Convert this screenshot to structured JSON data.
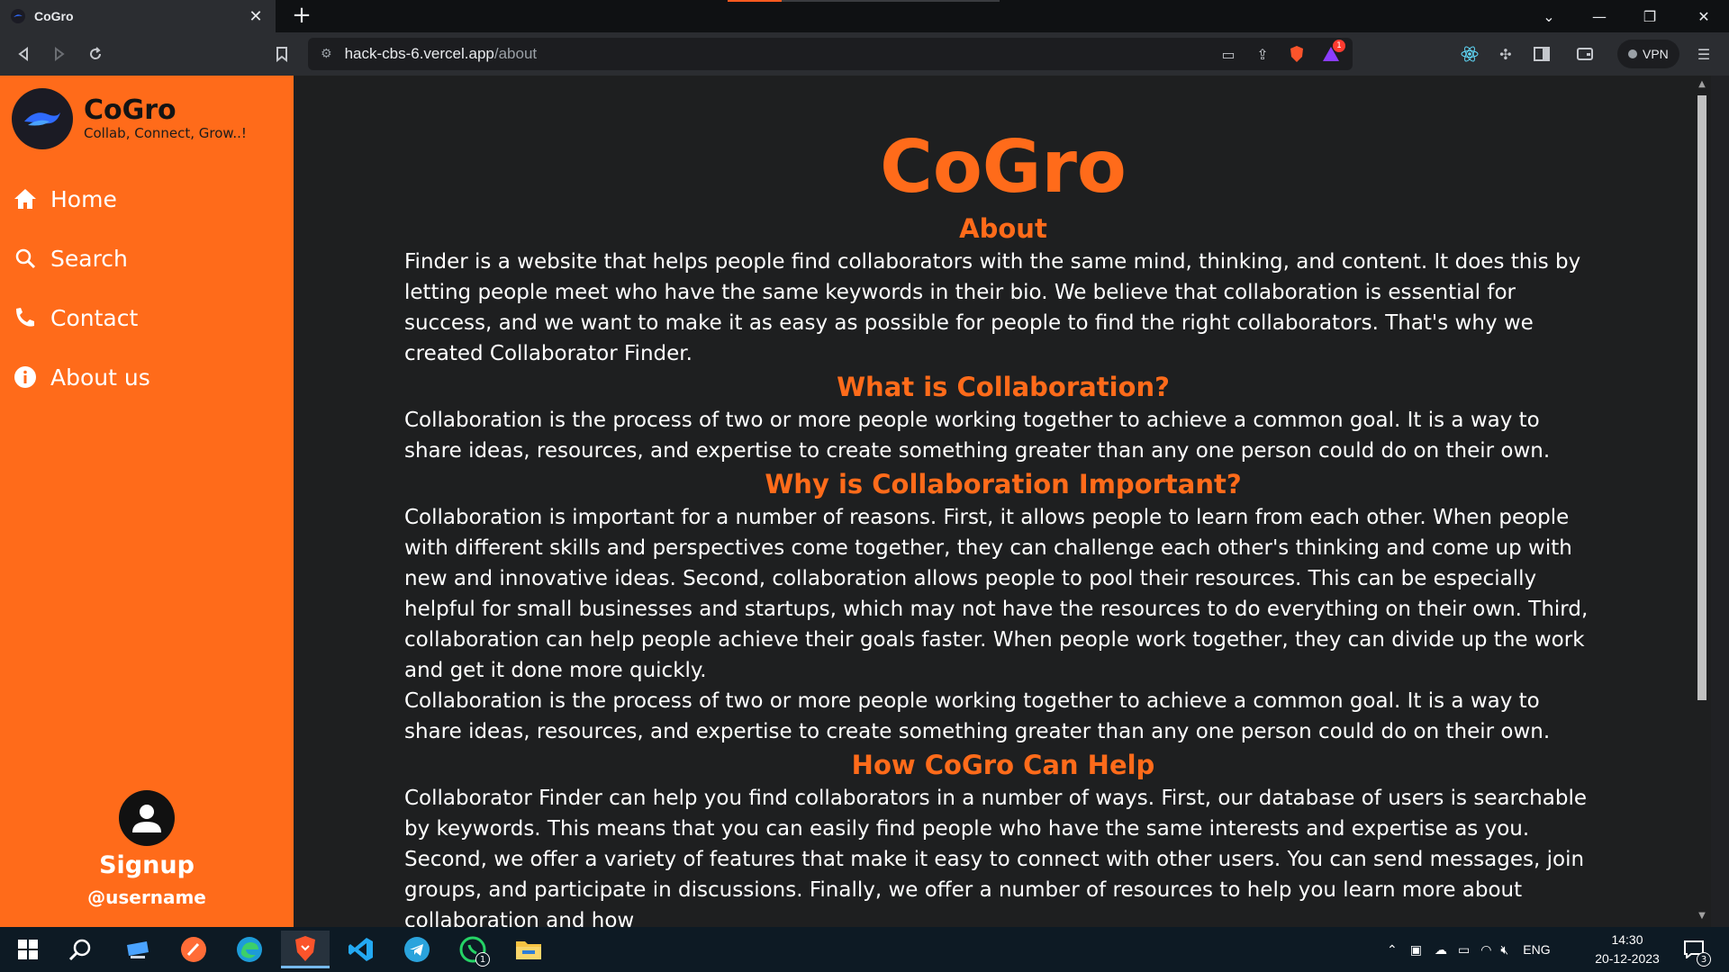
{
  "browser": {
    "tab_title": "CoGro",
    "url_host": "hack-cbs-6.vercel.app",
    "url_path": "/about",
    "vpn_label": "VPN",
    "notification_count": "1"
  },
  "sidebar": {
    "brand_name": "CoGro",
    "tagline": "Collab, Connect, Grow..!",
    "items": [
      {
        "label": "Home",
        "icon": "home-icon"
      },
      {
        "label": "Search",
        "icon": "search-icon"
      },
      {
        "label": "Contact",
        "icon": "phone-icon"
      },
      {
        "label": "About us",
        "icon": "info-icon"
      }
    ],
    "signup_label": "Signup",
    "username": "@username"
  },
  "main": {
    "title": "CoGro",
    "sections": [
      {
        "heading": "About",
        "paragraphs": [
          "Finder is a website that helps people find collaborators with the same mind, thinking, and content. It does this by letting people meet who have the same keywords in their bio. We believe that collaboration is essential for success, and we want to make it as easy as possible for people to find the right collaborators. That's why we created Collaborator Finder."
        ]
      },
      {
        "heading": "What is Collaboration?",
        "paragraphs": [
          "Collaboration is the process of two or more people working together to achieve a common goal. It is a way to share ideas, resources, and expertise to create something greater than any one person could do on their own."
        ]
      },
      {
        "heading": "Why is Collaboration Important?",
        "paragraphs": [
          "Collaboration is important for a number of reasons. First, it allows people to learn from each other. When people with different skills and perspectives come together, they can challenge each other's thinking and come up with new and innovative ideas. Second, collaboration allows people to pool their resources. This can be especially helpful for small businesses and startups, which may not have the resources to do everything on their own. Third, collaboration can help people achieve their goals faster. When people work together, they can divide up the work and get it done more quickly.",
          "Collaboration is the process of two or more people working together to achieve a common goal. It is a way to share ideas, resources, and expertise to create something greater than any one person could do on their own."
        ]
      },
      {
        "heading": "How CoGro Can Help",
        "paragraphs": [
          "Collaborator Finder can help you find collaborators in a number of ways. First, our database of users is searchable by keywords. This means that you can easily find people who have the same interests and expertise as you. Second, we offer a variety of features that make it easy to connect with other users. You can send messages, join groups, and participate in discussions. Finally, we offer a number of resources to help you learn more about collaboration and how"
        ]
      }
    ]
  },
  "taskbar": {
    "language": "ENG",
    "time": "14:30",
    "date": "20-12-2023",
    "whatsapp_badge": "1",
    "notifications_badge": "3"
  },
  "colors": {
    "accent": "#ff6b1a",
    "main_bg": "#1e1f20",
    "browser_bg": "#2b2d31"
  }
}
